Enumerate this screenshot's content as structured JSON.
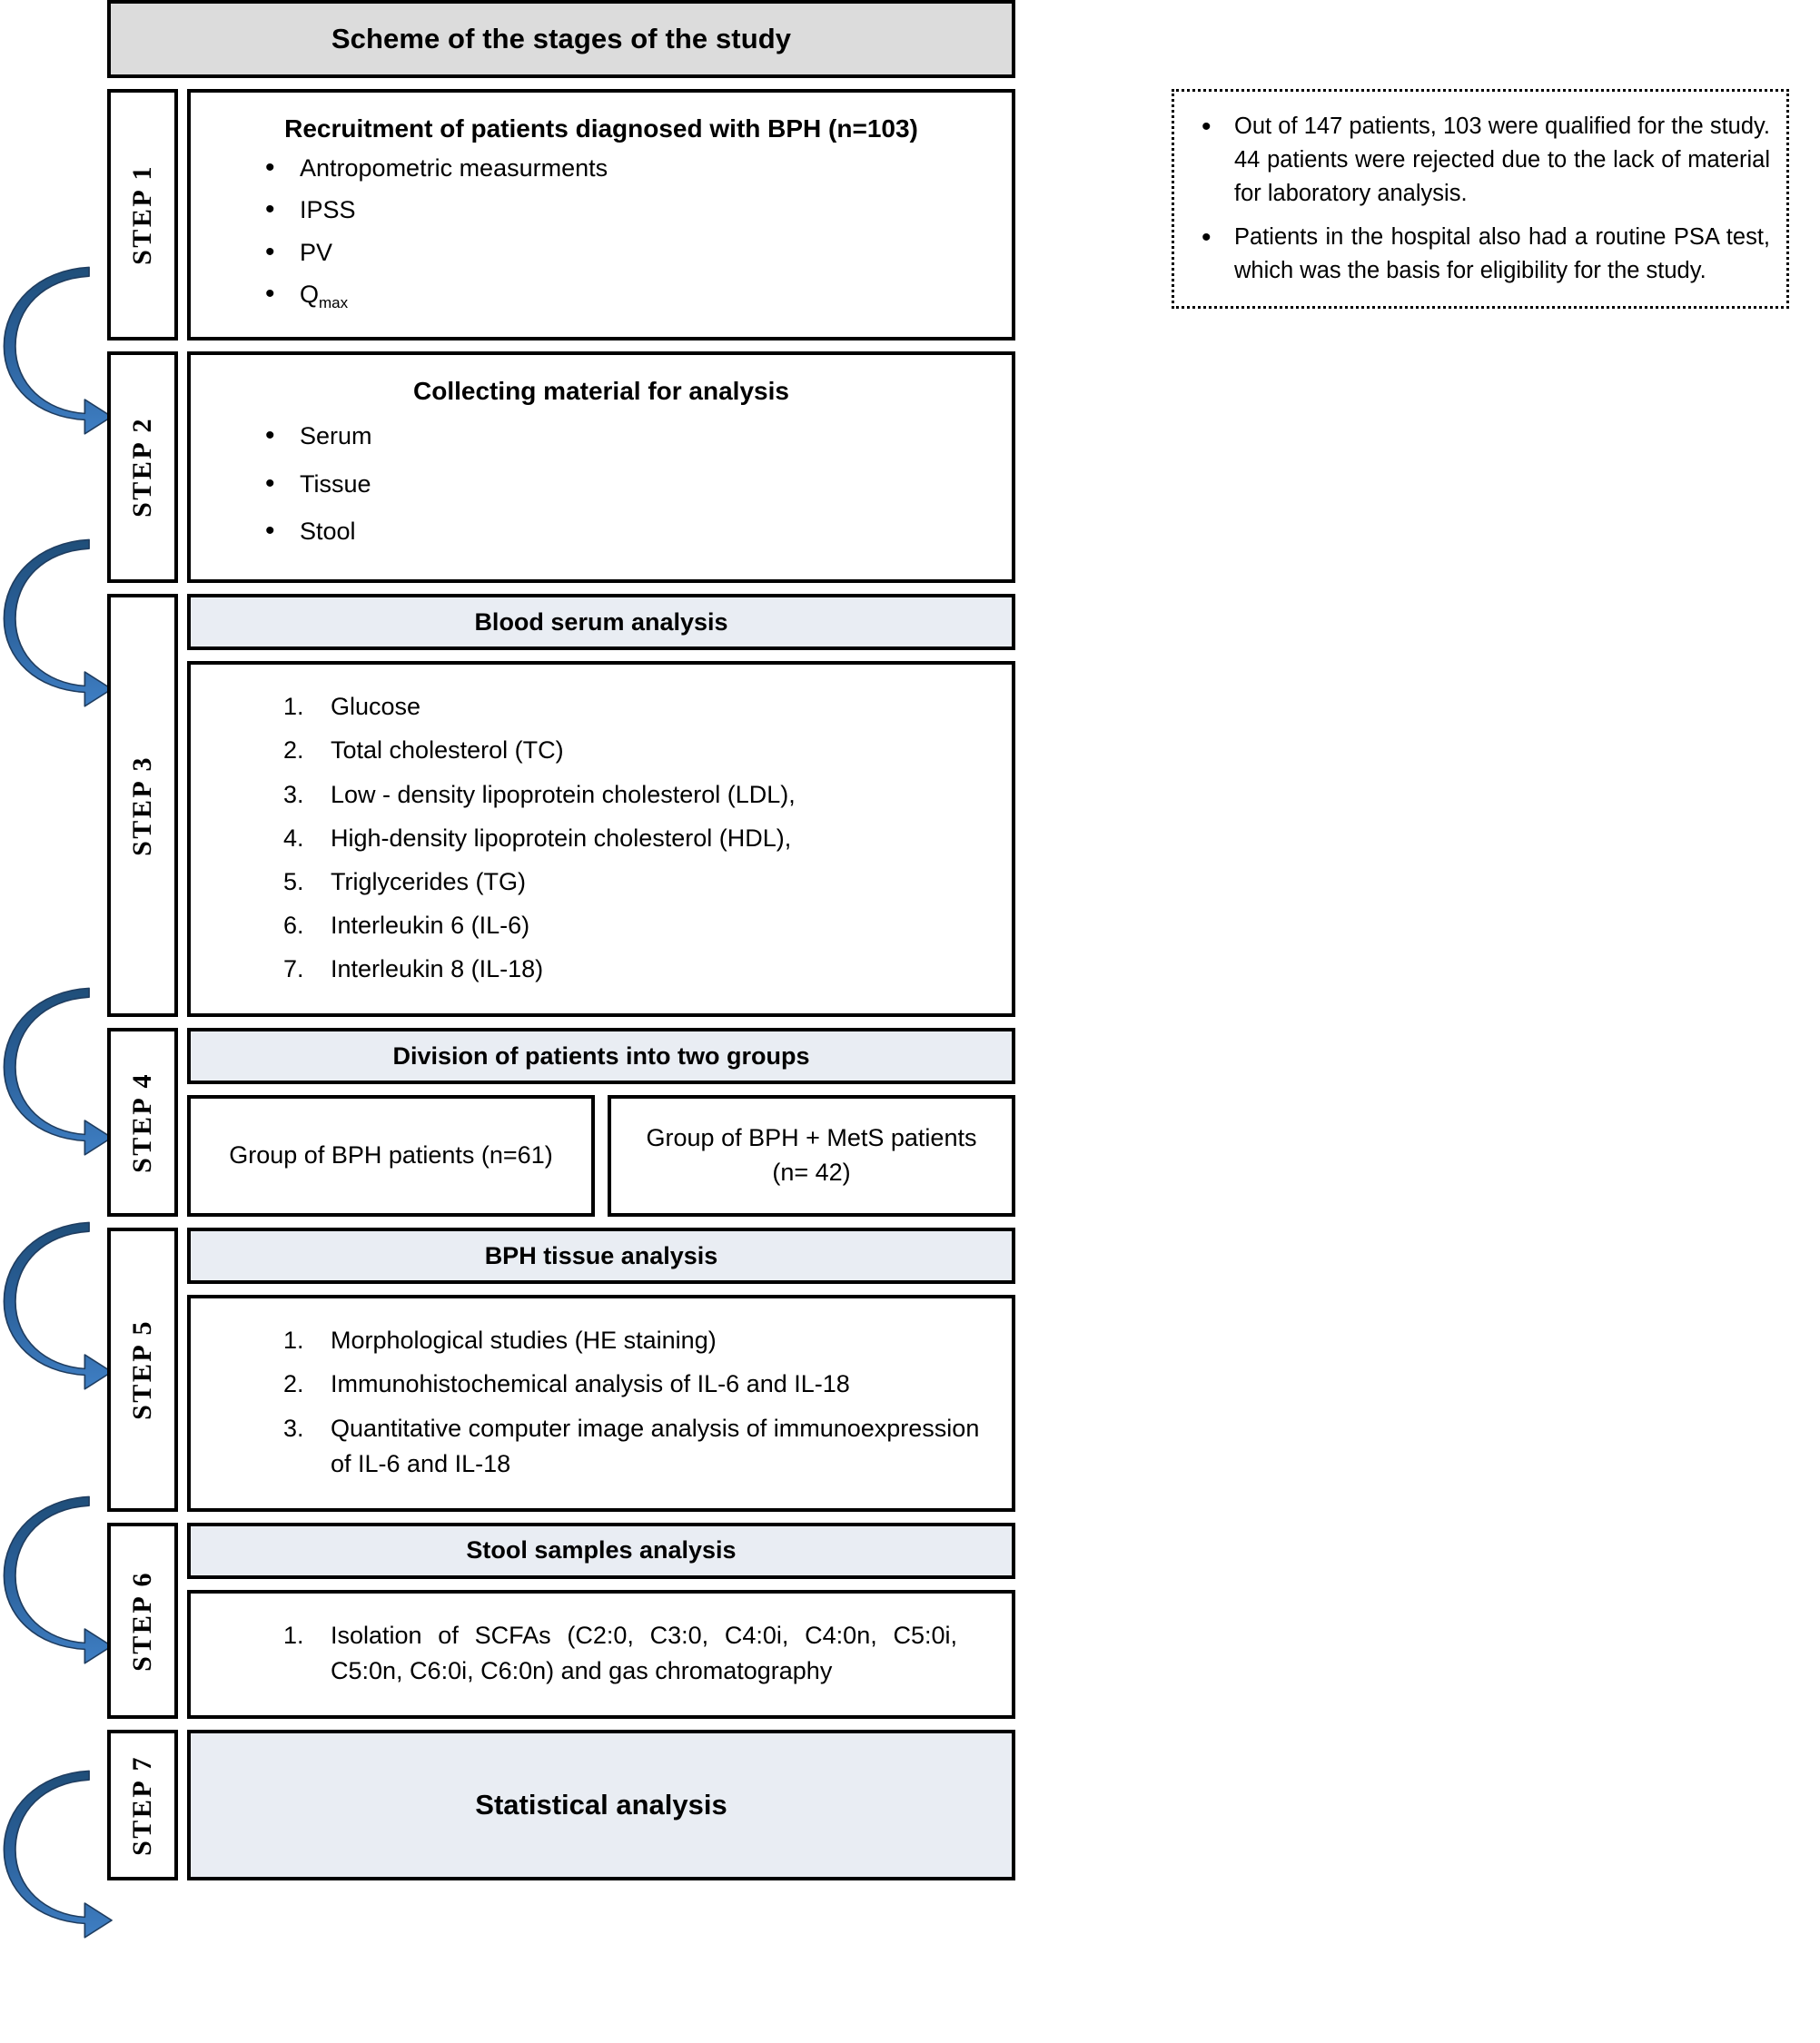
{
  "banner": {
    "title": "Scheme of the stages of the study"
  },
  "colors": {
    "banner_bg": "#dcdcdc",
    "header_bg": "#e9edf3",
    "arrow_fill": "#2e6db4",
    "arrow_fill_dark": "#1f4e79",
    "border": "#000000"
  },
  "steps": [
    {
      "tab": "STEP 1",
      "title": "Recruitment of patients diagnosed with BPH (n=103)",
      "title_style": "inline-bold",
      "list_type": "bullet",
      "items": [
        "Antropometric measurments",
        "IPSS",
        "PV",
        "Qmax"
      ]
    },
    {
      "tab": "STEP 2",
      "title": "Collecting material for analysis",
      "title_style": "inline-bold",
      "list_type": "bullet",
      "items": [
        "Serum",
        "Tissue",
        "Stool"
      ]
    },
    {
      "tab": "STEP 3",
      "title": "Blood serum analysis",
      "title_style": "header-bar",
      "list_type": "numbered",
      "items": [
        "Glucose",
        "Total cholesterol (TC)",
        "Low - density lipoprotein cholesterol (LDL),",
        "High-density lipoprotein cholesterol (HDL),",
        "Triglycerides (TG)",
        "Interleukin 6 (IL-6)",
        "Interleukin 8 (IL-18)"
      ]
    },
    {
      "tab": "STEP 4",
      "title": "Division of patients into two groups",
      "title_style": "header-bar",
      "list_type": "groups",
      "groups": [
        "Group of BPH patients (n=61)",
        "Group of BPH + MetS patients (n= 42)"
      ]
    },
    {
      "tab": "STEP 5",
      "title": "BPH tissue analysis",
      "title_style": "header-bar",
      "list_type": "numbered",
      "items": [
        "Morphological studies (HE staining)",
        "Immunohistochemical analysis of IL-6 and IL-18",
        "Quantitative computer image analysis of immunoexpression of IL-6 and IL-18"
      ]
    },
    {
      "tab": "STEP 6",
      "title": "Stool samples analysis",
      "title_style": "header-bar",
      "list_type": "numbered",
      "items": [
        "Isolation of SCFAs (C2:0, C3:0, C4:0i, C4:0n, C5:0i, C5:0n, C6:0i, C6:0n) and gas chromatography"
      ]
    },
    {
      "tab": "STEP 7",
      "title": "Statistical analysis",
      "title_style": "big-bar",
      "list_type": "none",
      "items": []
    }
  ],
  "sidenote": {
    "items": [
      "Out of 147 patients, 103 were qualified for the study. 44 patients were rejected due to the lack of material for laboratory analysis.",
      "Patients in the hospital also had a routine PSA test, which was the basis for eligibility for the study."
    ]
  },
  "arrows": {
    "count": 6,
    "label": "flow-arrow",
    "direction": "down-right-curve"
  }
}
